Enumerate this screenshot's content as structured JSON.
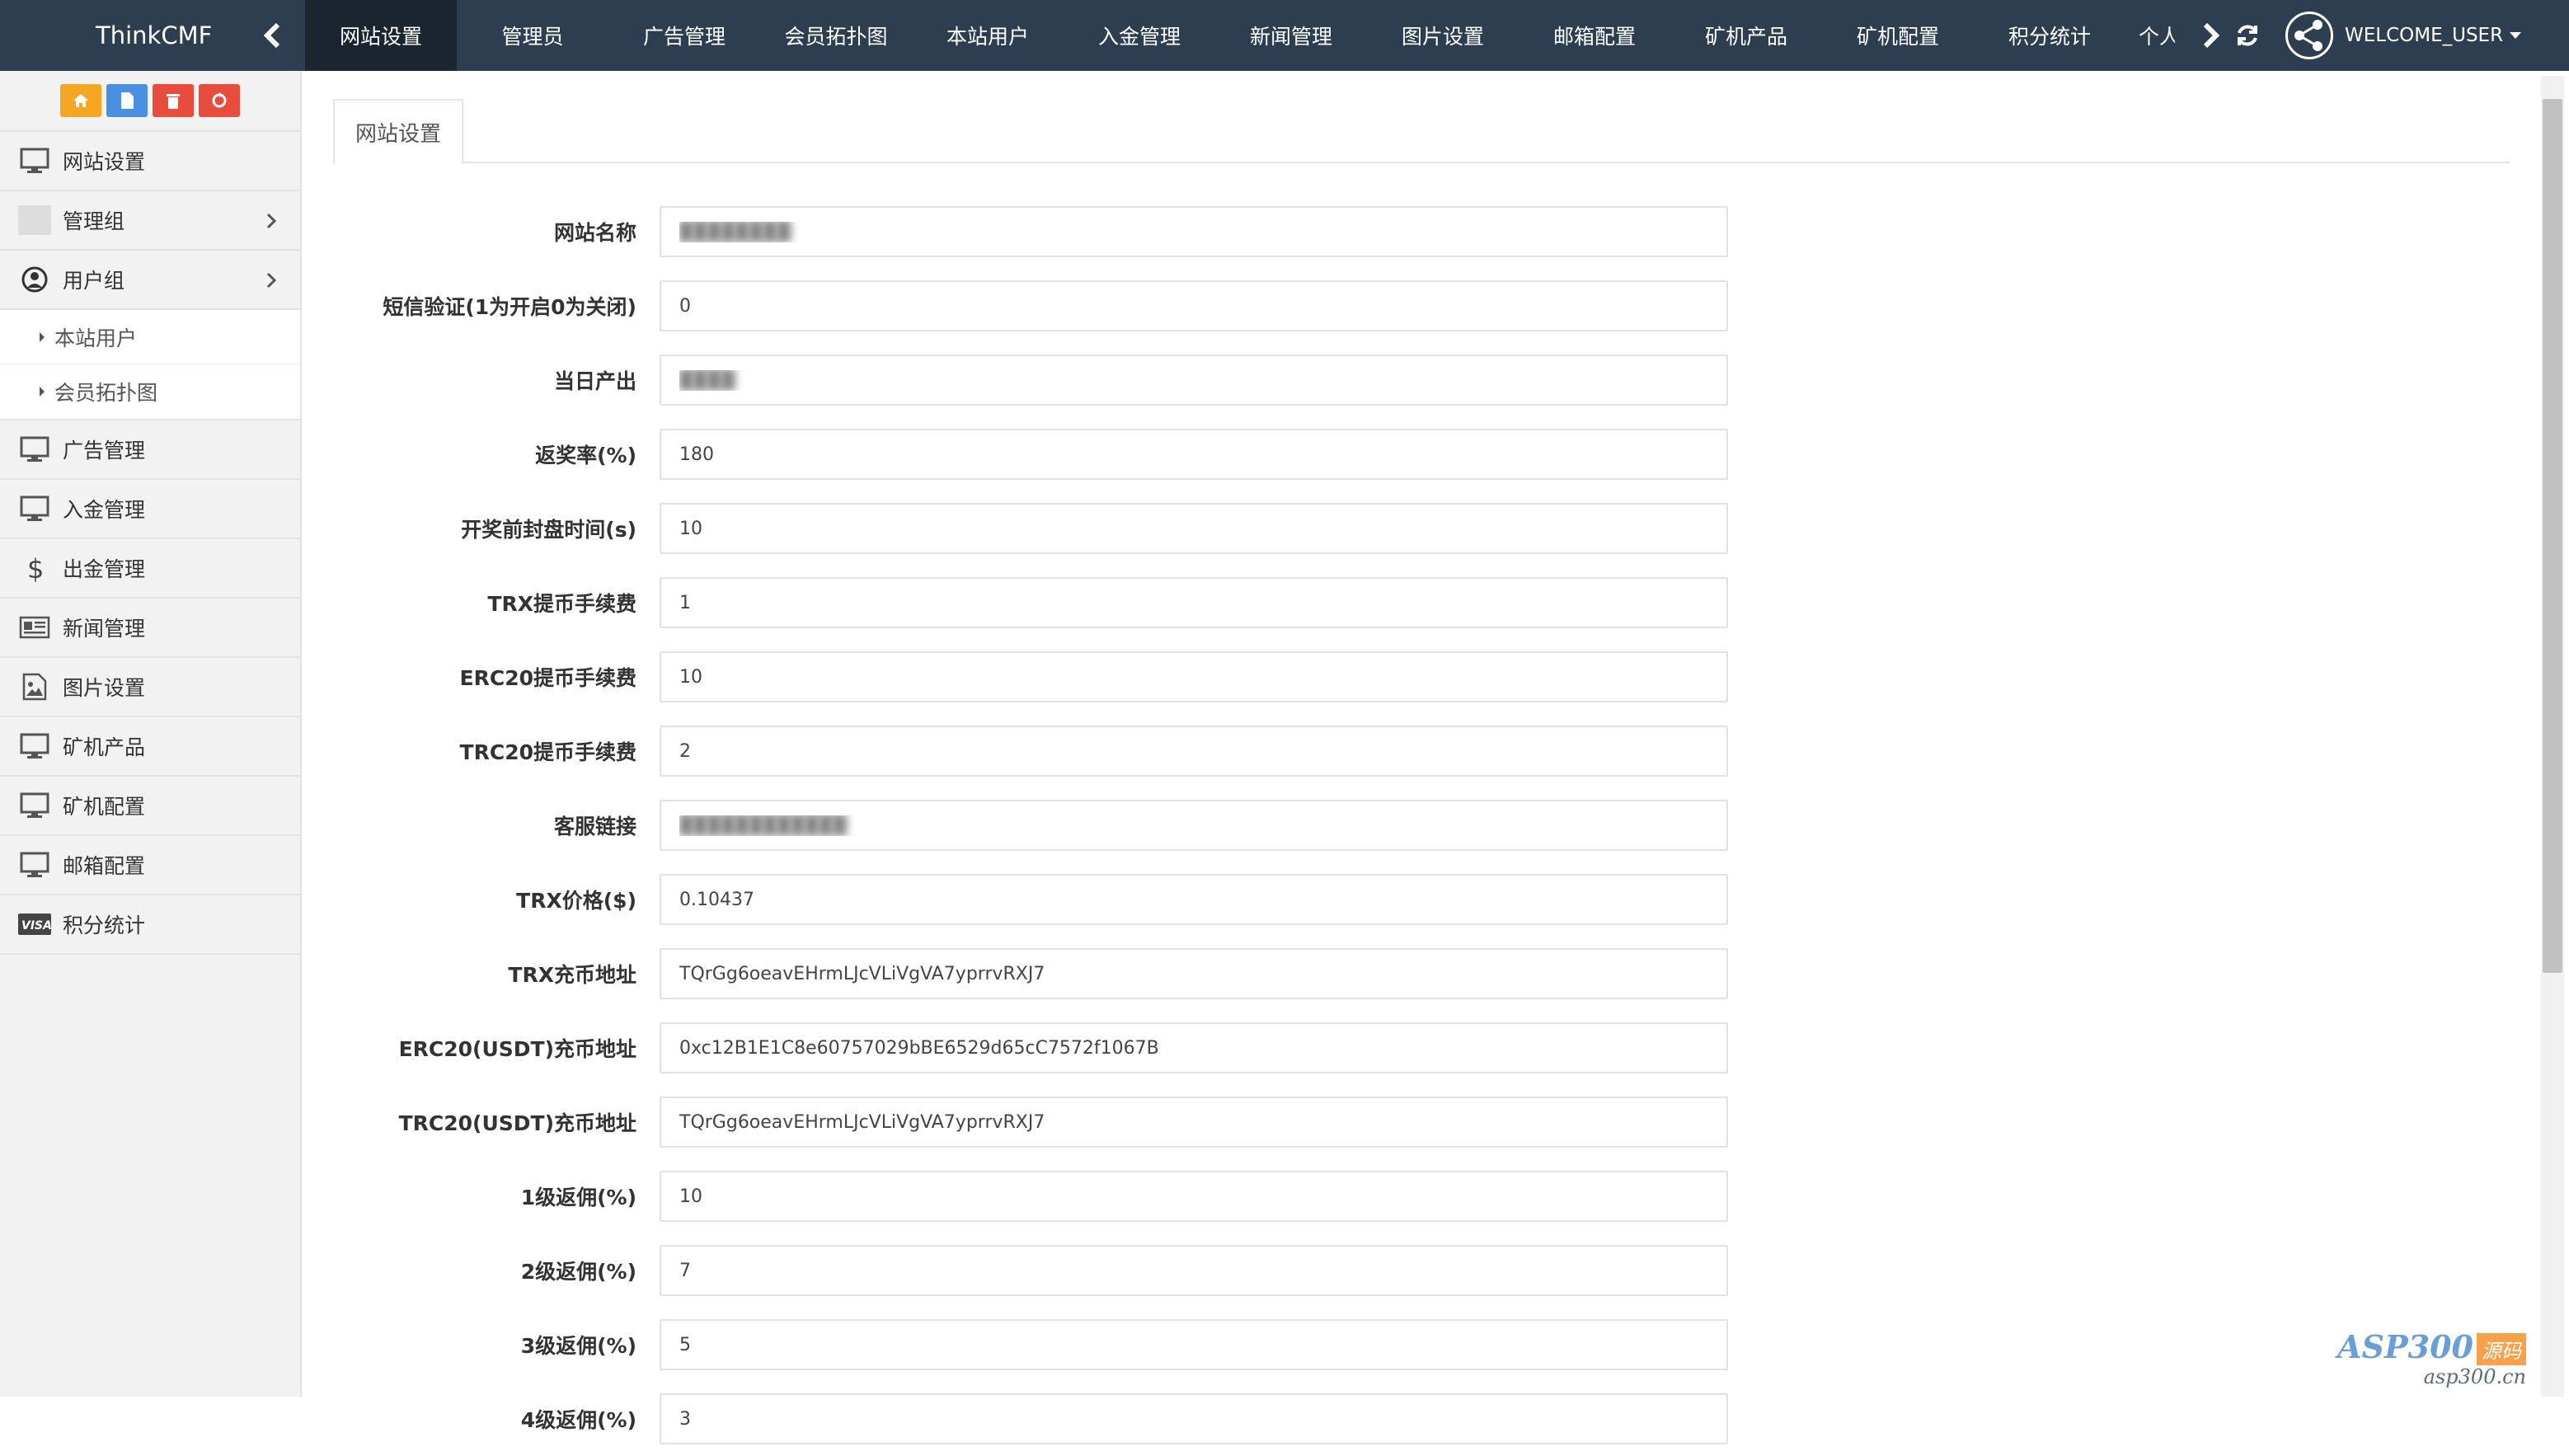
{
  "brand": "ThinkCMF",
  "colors": {
    "navbar": "#2c3e50",
    "nav_active": "#1a252f",
    "home": "#f5a623",
    "file": "#4a90e2",
    "trash": "#e74c3c",
    "recycle": "#e74c3c"
  },
  "nav": {
    "tabs": [
      "网站设置",
      "管理员",
      "广告管理",
      "会员拓扑图",
      "本站用户",
      "入金管理",
      "新闻管理",
      "图片设置",
      "邮箱配置",
      "矿机产品",
      "矿机配置",
      "积分统计"
    ],
    "partial_tab": "个人",
    "user": "WELCOME_USER"
  },
  "sidebar": {
    "items": [
      {
        "label": "网站设置",
        "icon": "monitor-icon"
      },
      {
        "label": "管理组",
        "icon": "placeholder-icon"
      },
      {
        "label": "用户组",
        "icon": "user-circle-icon"
      },
      {
        "label": "广告管理",
        "icon": "monitor-icon"
      },
      {
        "label": "入金管理",
        "icon": "monitor-icon"
      },
      {
        "label": "出金管理",
        "icon": "dollar-icon"
      },
      {
        "label": "新闻管理",
        "icon": "newspaper-icon"
      },
      {
        "label": "图片设置",
        "icon": "image-icon"
      },
      {
        "label": "矿机产品",
        "icon": "monitor-icon"
      },
      {
        "label": "矿机配置",
        "icon": "monitor-icon"
      },
      {
        "label": "邮箱配置",
        "icon": "monitor-icon"
      },
      {
        "label": "积分统计",
        "icon": "visa-card-icon"
      }
    ],
    "user_sub": [
      "本站用户",
      "会员拓扑图"
    ]
  },
  "main": {
    "tab_label": "网站设置",
    "fields": [
      {
        "label": "网站名称",
        "value": "████████",
        "blurred": true
      },
      {
        "label": "短信验证(1为开启0为关闭)",
        "value": "0"
      },
      {
        "label": "当日产出",
        "value": "████",
        "blurred": true
      },
      {
        "label": "返奖率(%)",
        "value": "180"
      },
      {
        "label": "开奖前封盘时间(s)",
        "value": "10"
      },
      {
        "label": "TRX提币手续费",
        "value": "1"
      },
      {
        "label": "ERC20提币手续费",
        "value": "10"
      },
      {
        "label": "TRC20提币手续费",
        "value": "2"
      },
      {
        "label": "客服链接",
        "value": "████████████",
        "blurred": true
      },
      {
        "label": "TRX价格($)",
        "value": "0.10437"
      },
      {
        "label": "TRX充币地址",
        "value": "TQrGg6oeavEHrmLJcVLiVgVA7yprrvRXJ7"
      },
      {
        "label": "ERC20(USDT)充币地址",
        "value": "0xc12B1E1C8e60757029bBE6529d65cC7572f1067B"
      },
      {
        "label": "TRC20(USDT)充币地址",
        "value": "TQrGg6oeavEHrmLJcVLiVgVA7yprrvRXJ7"
      },
      {
        "label": "1级返佣(%)",
        "value": "10"
      },
      {
        "label": "2级返佣(%)",
        "value": "7"
      },
      {
        "label": "3级返佣(%)",
        "value": "5"
      },
      {
        "label": "4级返佣(%)",
        "value": "3"
      }
    ]
  },
  "watermark": {
    "top": "ASP300",
    "badge": "源码",
    "bottom": "asp300.cn"
  }
}
